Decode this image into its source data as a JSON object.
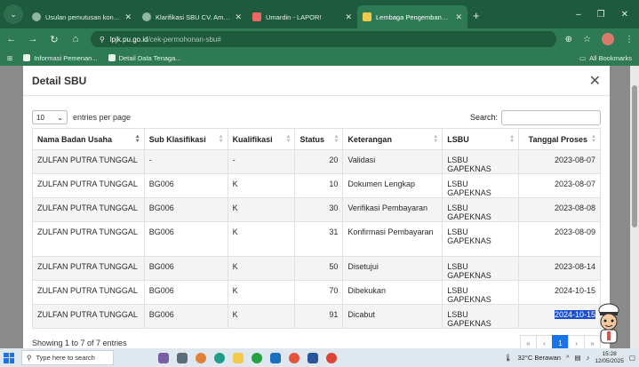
{
  "browser": {
    "tabs": [
      {
        "label": "Usulan pemutusan kontrak CV",
        "active": false
      },
      {
        "label": "Klarifikasi SBU CV. Amanah Ray",
        "active": false
      },
      {
        "label": "Umardin - LAPOR!",
        "active": false
      },
      {
        "label": "Lembaga Pengembangan Jasa",
        "active": true
      }
    ],
    "new_tab": "+",
    "window_controls": [
      "–",
      "❐",
      "✕"
    ],
    "url_host": "lpjk.pu.go.id",
    "url_path": "/cek-permohonan-sbu#",
    "bookmarks": [
      "Informasi Pemenan...",
      "Detail Data Tenaga..."
    ],
    "all_bookmarks": "All Bookmarks"
  },
  "modal": {
    "title": "Detail SBU",
    "close": "✕",
    "length_value": "10",
    "length_label": "entries per page",
    "search_label": "Search:",
    "search_value": "",
    "columns": [
      "Nama Badan Usaha",
      "Sub Klasifikasi",
      "Kualifikasi",
      "Status",
      "Keterangan",
      "LSBU",
      "Tanggal Proses"
    ],
    "rows": [
      {
        "nama": "ZULFAN PUTRA TUNGGAL",
        "sub": "-",
        "kual": "-",
        "status": "20",
        "ket": "Validasi",
        "lsbu": "LSBU GAPEKNAS",
        "tgl": "2023-08-07"
      },
      {
        "nama": "ZULFAN PUTRA TUNGGAL",
        "sub": "BG006",
        "kual": "K",
        "status": "10",
        "ket": "Dokumen Lengkap",
        "lsbu": "LSBU GAPEKNAS",
        "tgl": "2023-08-07"
      },
      {
        "nama": "ZULFAN PUTRA TUNGGAL",
        "sub": "BG006",
        "kual": "K",
        "status": "30",
        "ket": "Verifikasi Pembayaran",
        "lsbu": "LSBU GAPEKNAS",
        "tgl": "2023-08-08"
      },
      {
        "nama": "ZULFAN PUTRA TUNGGAL",
        "sub": "BG006",
        "kual": "K",
        "status": "31",
        "ket": "Konfirmasi Pembayaran",
        "lsbu": "LSBU GAPEKNAS",
        "tgl": "2023-08-09"
      },
      {
        "nama": "ZULFAN PUTRA TUNGGAL",
        "sub": "BG006",
        "kual": "K",
        "status": "50",
        "ket": "Disetujui",
        "lsbu": "LSBU GAPEKNAS",
        "tgl": "2023-08-14"
      },
      {
        "nama": "ZULFAN PUTRA TUNGGAL",
        "sub": "BG006",
        "kual": "K",
        "status": "70",
        "ket": "Dibekukan",
        "lsbu": "LSBU GAPEKNAS",
        "tgl": "2024-10-15"
      },
      {
        "nama": "ZULFAN PUTRA TUNGGAL",
        "sub": "BG006",
        "kual": "K",
        "status": "91",
        "ket": "Dicabut",
        "lsbu": "LSBU GAPEKNAS",
        "tgl": "2024-10-15"
      }
    ],
    "info": "Showing 1 to 7 of 7 entries",
    "pager": [
      "«",
      "‹",
      "1",
      "›",
      "»"
    ],
    "current_page": "1"
  },
  "taskbar": {
    "search_placeholder": "Type here to search",
    "weather": "32°C  Berawan",
    "time": "15:28",
    "date": "12/05/2025"
  },
  "colors": {
    "chrome_dark": "#1e5a3d",
    "chrome": "#2e7a55",
    "selection": "#1b4fd1",
    "page_active": "#1a73e8"
  }
}
